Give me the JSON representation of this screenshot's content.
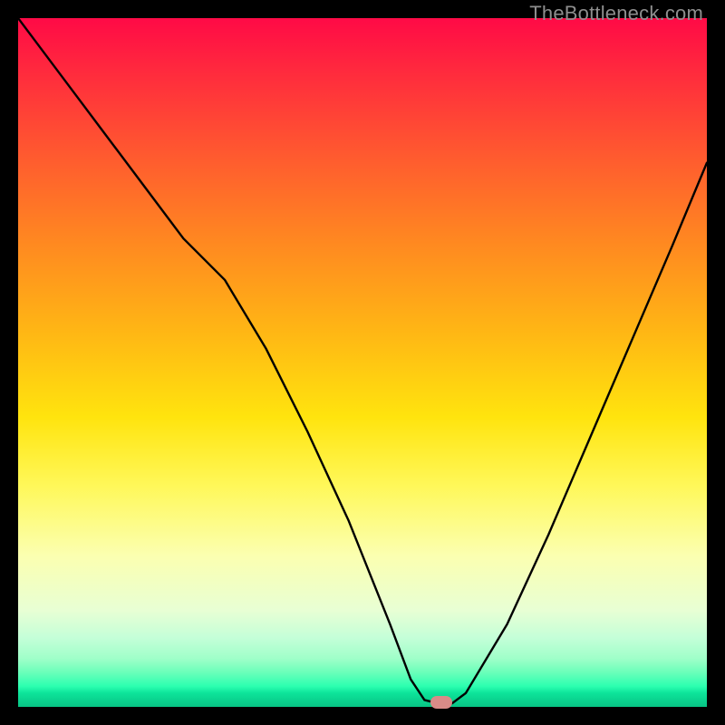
{
  "watermark": "TheBottleneck.com",
  "marker": {
    "x_pct": 61.5,
    "y_pct": 99.3
  },
  "chart_data": {
    "type": "line",
    "title": "",
    "xlabel": "",
    "ylabel": "",
    "xlim": [
      0,
      100
    ],
    "ylim": [
      0,
      100
    ],
    "grid": false,
    "legend": false,
    "series": [
      {
        "name": "bottleneck-curve",
        "x": [
          0,
          6,
          12,
          18,
          24,
          30,
          36,
          42,
          48,
          54,
          57,
          59,
          61,
          63,
          65,
          71,
          77,
          83,
          89,
          95,
          100
        ],
        "y": [
          100,
          92,
          84,
          76,
          68,
          62,
          52,
          40,
          27,
          12,
          4,
          1,
          0.5,
          0.5,
          2,
          12,
          25,
          39,
          53,
          67,
          79
        ]
      }
    ],
    "annotations": [
      {
        "type": "marker",
        "x": 61.5,
        "y": 0.7,
        "label": "optimal-point"
      }
    ],
    "background": "vertical-gradient red→yellow→green (top=high bottleneck, bottom=low)"
  }
}
